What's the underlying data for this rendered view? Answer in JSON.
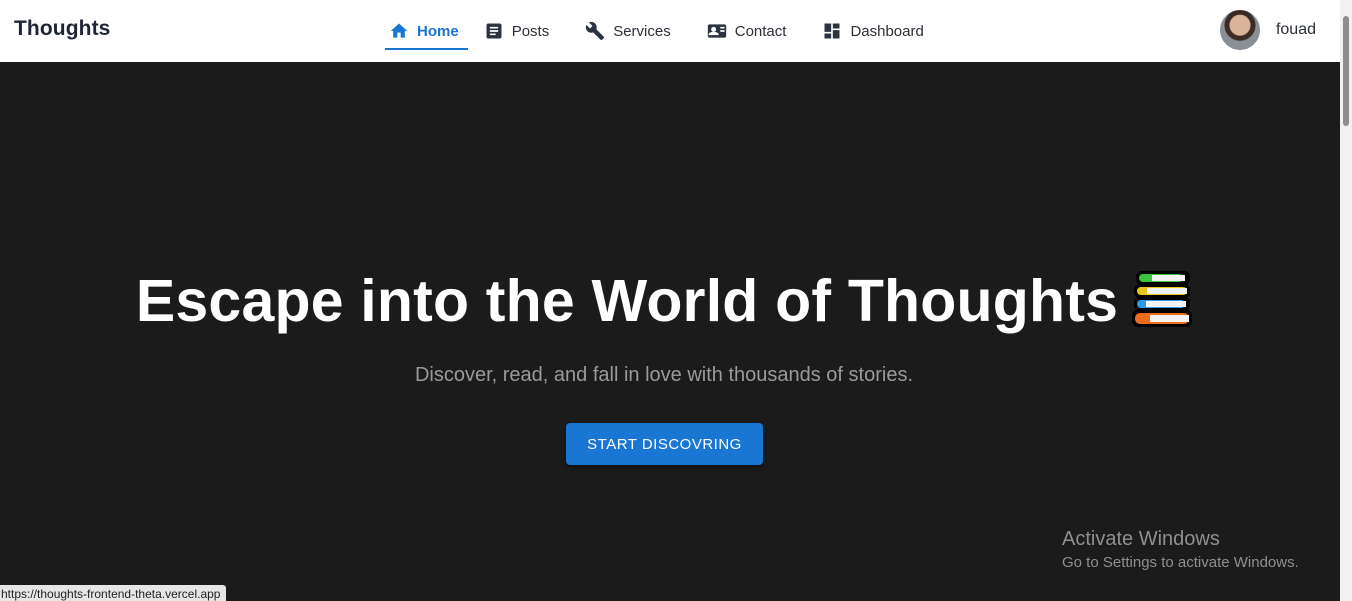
{
  "brand": "Thoughts",
  "nav": [
    {
      "label": "Home",
      "icon": "home-icon",
      "active": true
    },
    {
      "label": "Posts",
      "icon": "article-icon",
      "active": false
    },
    {
      "label": "Services",
      "icon": "wrench-icon",
      "active": false
    },
    {
      "label": "Contact",
      "icon": "contact-card-icon",
      "active": false
    },
    {
      "label": "Dashboard",
      "icon": "dashboard-icon",
      "active": false
    }
  ],
  "user": {
    "name": "fouad"
  },
  "hero": {
    "title": "Escape into the World of Thoughts",
    "emoji": "books-icon",
    "subtitle": "Discover, read, and fall in love with thousands of stories.",
    "cta": "START DISCOVRING"
  },
  "watermark": {
    "line1": "Activate Windows",
    "line2": "Go to Settings to activate Windows."
  },
  "status_url": "https://thoughts-frontend-theta.vercel.app",
  "colors": {
    "accent": "#1976d2",
    "background": "#1b1b1b",
    "navbar": "#ffffff"
  }
}
